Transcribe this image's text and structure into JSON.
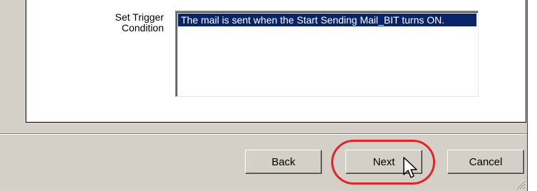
{
  "form": {
    "trigger_label_line1": "Set Trigger",
    "trigger_label_line2": "Condition",
    "trigger_list_items": [
      "The mail is sent when the Start Sending Mail_BIT turns ON."
    ]
  },
  "buttons": {
    "back_label": "Back",
    "next_label": "Next",
    "cancel_label": "Cancel"
  },
  "icons": {
    "cursor": "mouse-pointer-icon",
    "resize": "resize-grip-icon"
  },
  "colors": {
    "highlight_ring": "#e0242a",
    "selection": "#0a246a",
    "dialog_bg": "#d4d0c8"
  }
}
